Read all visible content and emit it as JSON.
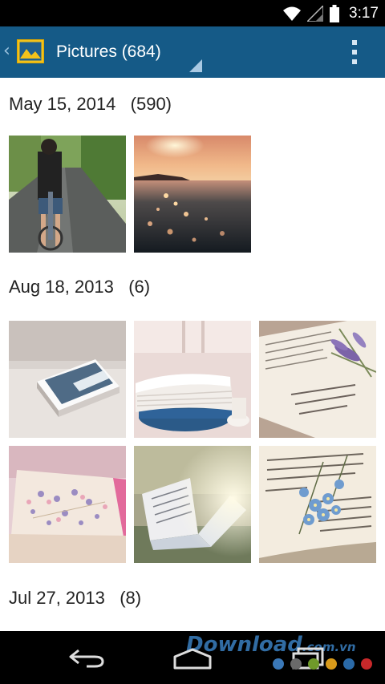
{
  "status_bar": {
    "time": "3:17",
    "icons": [
      "wifi-icon",
      "cell-signal-icon",
      "battery-icon"
    ]
  },
  "action_bar": {
    "title": "Pictures (684)",
    "icons": [
      "back-chevron-icon",
      "gallery-app-icon",
      "spinner-caret-icon",
      "overflow-menu-icon"
    ],
    "background": "#155a87"
  },
  "sections": [
    {
      "label": "May 15, 2014   (590)",
      "photos": [
        "girl-cycling-photo",
        "sunset-sea-photo"
      ]
    },
    {
      "label": "Aug 18, 2013   (6)",
      "photos": [
        "closed-book-photo",
        "stacked-books-photo",
        "open-book-lavender-photo",
        "notebook-flowers-photo",
        "open-book-sunlight-photo",
        "book-blue-flowers-photo"
      ]
    },
    {
      "label": "Jul 27, 2013   (8)",
      "photos": []
    }
  ],
  "nav_bar": {
    "icons": [
      "back-icon",
      "home-icon",
      "recents-icon"
    ],
    "watermark": "Download",
    "watermark_suffix": ".com.vn"
  }
}
